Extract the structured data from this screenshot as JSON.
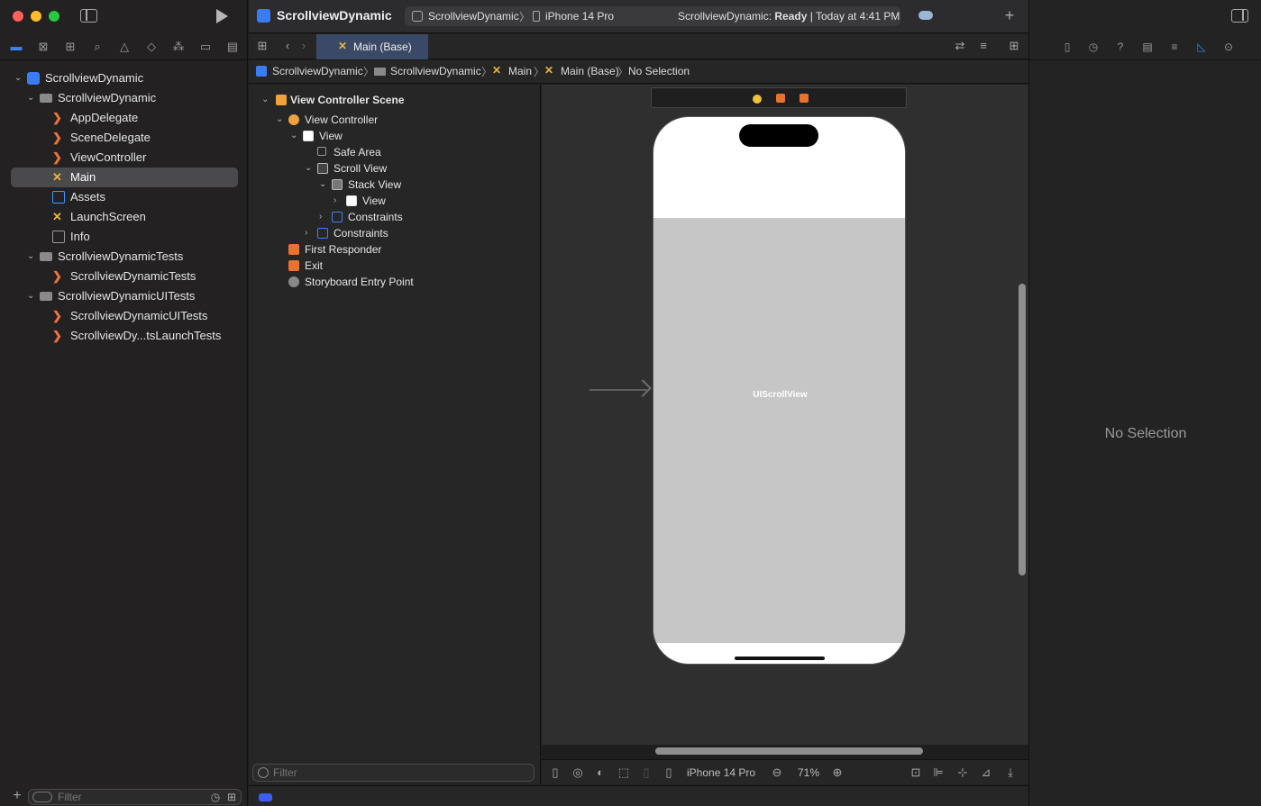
{
  "navigator": {
    "tree": [
      {
        "label": "ScrollviewDynamic",
        "kind": "project"
      },
      {
        "label": "ScrollviewDynamic",
        "kind": "folder"
      },
      {
        "label": "AppDelegate",
        "kind": "swift"
      },
      {
        "label": "SceneDelegate",
        "kind": "swift"
      },
      {
        "label": "ViewController",
        "kind": "swift"
      },
      {
        "label": "Main",
        "kind": "storyboard",
        "selected": true
      },
      {
        "label": "Assets",
        "kind": "assets"
      },
      {
        "label": "LaunchScreen",
        "kind": "storyboard"
      },
      {
        "label": "Info",
        "kind": "plist"
      },
      {
        "label": "ScrollviewDynamicTests",
        "kind": "folder"
      },
      {
        "label": "ScrollviewDynamicTests",
        "kind": "swift"
      },
      {
        "label": "ScrollviewDynamicUITests",
        "kind": "folder"
      },
      {
        "label": "ScrollviewDynamicUITests",
        "kind": "swift"
      },
      {
        "label": "ScrollviewDy...tsLaunchTests",
        "kind": "swift"
      }
    ],
    "filter_placeholder": "Filter"
  },
  "toolbar": {
    "project_title": "ScrollviewDynamic",
    "scheme": "ScrollviewDynamic",
    "device": "iPhone 14 Pro",
    "status_prefix": "ScrollviewDynamic: ",
    "status_bold": "Ready",
    "status_suffix": " | Today at 4:41 PM"
  },
  "editor": {
    "tab_label": "Main (Base)",
    "jumpbar": [
      "ScrollviewDynamic",
      "ScrollviewDynamic",
      "Main",
      "Main (Base)",
      "No Selection"
    ]
  },
  "outline": {
    "rows": [
      "View Controller Scene",
      "View Controller",
      "View",
      "Safe Area",
      "Scroll View",
      "Stack View",
      "View",
      "Constraints",
      "Constraints",
      "First Responder",
      "Exit",
      "Storyboard Entry Point"
    ],
    "filter_placeholder": "Filter"
  },
  "canvas": {
    "scrollview_label": "UIScrollView",
    "device_label": "iPhone 14 Pro",
    "zoom": "71%"
  },
  "inspector": {
    "empty_label": "No Selection"
  },
  "colors": {
    "accent": "#3b82f6",
    "swift": "#f0743e",
    "storyboard": "#e8b53c"
  }
}
